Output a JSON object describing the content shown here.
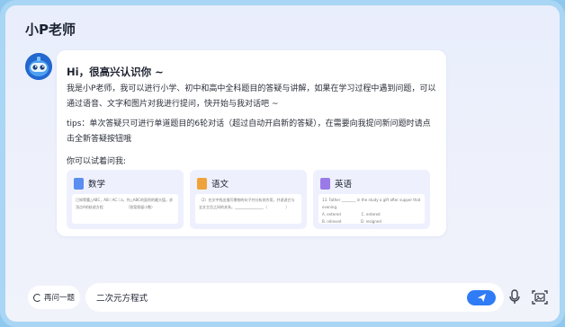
{
  "app": {
    "title": "小P老师"
  },
  "assistant": {
    "avatar": "robot-avatar-icon",
    "greeting": "Hi，很高兴认识你 ~",
    "intro": "我是小P老师，我可以进行小学、初中和高中全科题目的答疑与讲解，如果在学习过程中遇到问题，可以通过语音、文字和图片对我进行提问，快开始与我对话吧 ~",
    "tips": "tips：单次答疑只可进行单道题目的6轮对话（超过自动开启新的答疑），在需要向我提问新问题时请点击全新答疑按钮哦",
    "try_label": "你可以试着问我:",
    "samples": [
      {
        "subject": "数学",
        "icon": "math-book-icon",
        "color": "#5b8cf0",
        "preview": "已知等腰△ABC，AB＝AC＝a，作△ABC的面积的最大值，求顶点A的轨迹方程                    （答案保留小数）"
      },
      {
        "subject": "语文",
        "icon": "chinese-book-icon",
        "color": "#f0a23a",
        "preview": "（2）在文中找出描写景物的句子并分析其作用，并说说它与全文主旨之间的关系。________________（                ）"
      },
      {
        "subject": "英语",
        "icon": "english-book-icon",
        "color": "#9a7ae8",
        "preview": "13. Father ________ in the study a gift after supper that evening.\nA. entered                  C. entered\nB. relieved                 D. resigned"
      }
    ]
  },
  "bottom_bar": {
    "again_label": "再问一题",
    "again_icon": "refresh-icon",
    "input_value": "二次元方程式",
    "send_icon": "send-icon",
    "mic_icon": "microphone-icon",
    "image_icon": "image-upload-icon"
  },
  "colors": {
    "accent": "#2f7cf6",
    "frame": "#a9d6f4"
  }
}
